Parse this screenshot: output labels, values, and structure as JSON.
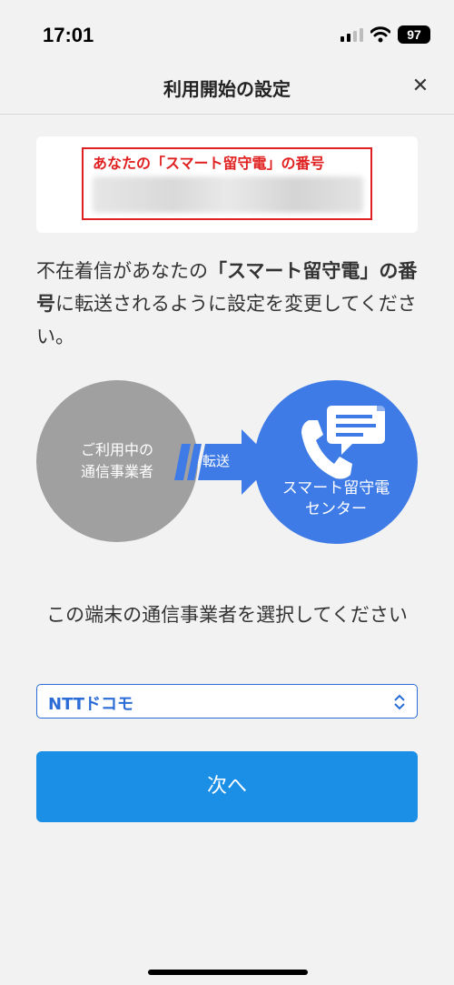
{
  "status_bar": {
    "time": "17:01",
    "battery": "97"
  },
  "header": {
    "title": "利用開始の設定",
    "close_label": "✕"
  },
  "number_card": {
    "label": "あなたの「スマート留守電」の番号"
  },
  "instruction": {
    "part1": "不在着信があなたの",
    "bold": "「スマート留守電」の番号",
    "part2": "に転送されるように設定を変更してください。"
  },
  "diagram": {
    "left_line1": "ご利用中の",
    "left_line2": "通信事業者",
    "arrow_label": "転送",
    "right_line1": "スマート留守電",
    "right_line2": "センター"
  },
  "carrier": {
    "prompt": "この端末の通信事業者を選択してください",
    "selected": "NTTドコモ"
  },
  "next_button": {
    "label": "次へ"
  },
  "colors": {
    "accent": "#1b8fe6",
    "highlight": "#e02020",
    "center_blue": "#3f7be6",
    "carrier_gray": "#a0a0a0"
  }
}
